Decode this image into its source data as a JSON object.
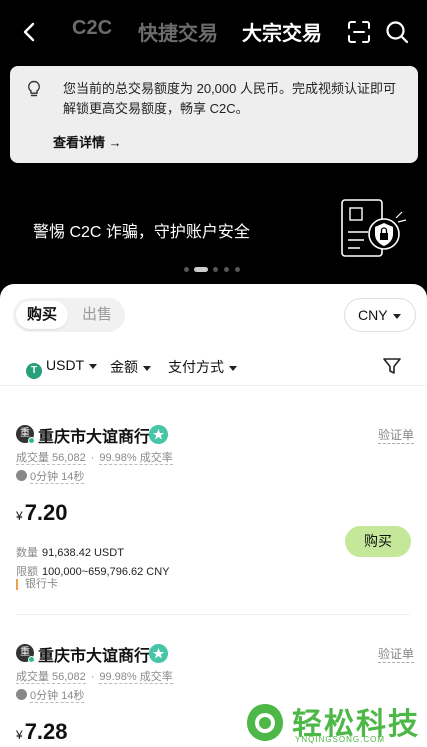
{
  "header": {
    "tabs": [
      {
        "label": "C2C"
      },
      {
        "label": "快捷交易"
      },
      {
        "label": "大宗交易"
      }
    ]
  },
  "notice": {
    "text": "您当前的总交易额度为 20,000 人民币。完成视频认证即可解锁更高交易额度，畅享 C2C。",
    "link_label": "查看详情 →"
  },
  "banner": {
    "slogan": "警惕 C2C 诈骗，守护账户安全",
    "page_index": 1,
    "page_count": 5
  },
  "trade": {
    "side_tabs": [
      "购买",
      "出售"
    ],
    "currency": "CNY",
    "filters": {
      "coin": "USDT",
      "amount": "金额",
      "payment": "支付方式"
    }
  },
  "ads": [
    {
      "merchant": "重庆市大谊商行",
      "avatar_char": "重",
      "verify_label": "验证单",
      "volume": "成交量 56,082",
      "rate": "99.98% 成交率",
      "time": "0分钟 14秒",
      "currency_symbol": "¥",
      "price": "7.20",
      "qty_label": "数量",
      "qty": "91,638.42 USDT",
      "limit_label": "限额",
      "limit": "100,000~659,796.62 CNY",
      "buy_label": "购买",
      "payment": "银行卡"
    },
    {
      "merchant": "重庆市大谊商行",
      "avatar_char": "重",
      "verify_label": "验证单",
      "volume": "成交量 56,082",
      "rate": "99.98% 成交率",
      "time": "0分钟 14秒",
      "currency_symbol": "¥",
      "price": "7.28"
    }
  ],
  "watermark": {
    "title": "轻松科技",
    "subtitle": "YNQINGSONG.COM"
  },
  "colors": {
    "accent_green": "#2ebd85",
    "buy_button": "#c4e79a",
    "watermark_green": "#4db848"
  }
}
